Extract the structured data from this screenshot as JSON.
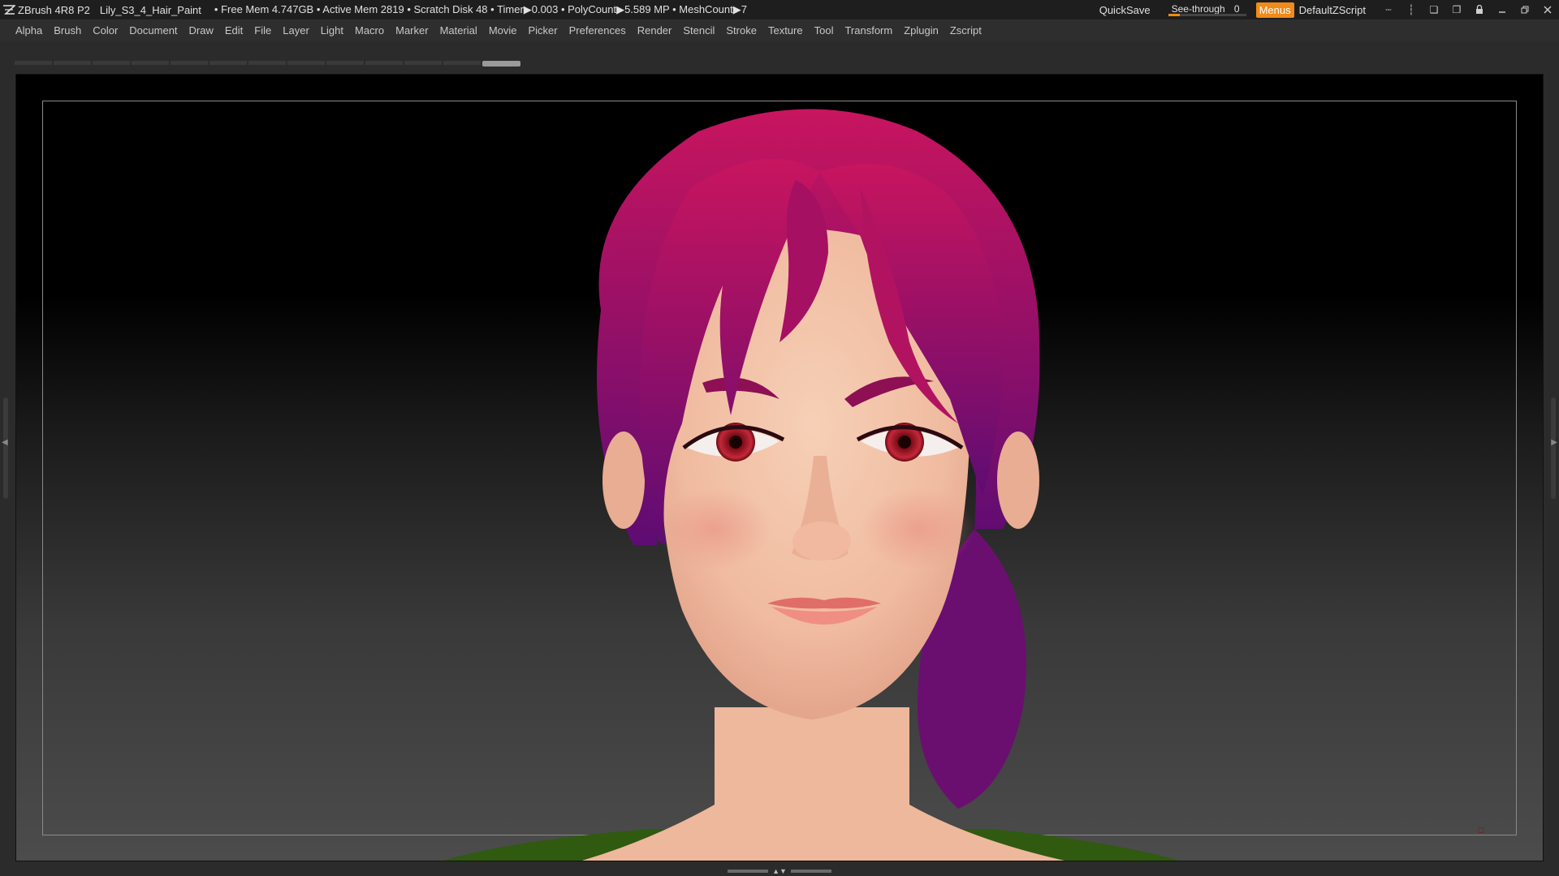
{
  "titlebar": {
    "app": "ZBrush 4R8 P2",
    "file": "Lily_S3_4_Hair_Paint",
    "stats": "• Free Mem 4.747GB • Active Mem 2819 • Scratch Disk 48 •  Timer▶0.003 • PolyCount▶5.589 MP  • MeshCount▶7",
    "quicksave": "QuickSave",
    "see_through_label": "See-through",
    "see_through_value": "0",
    "see_through_fraction": 0,
    "menus_label": "Menus",
    "zscript_label": "DefaultZScript"
  },
  "menubar": {
    "items": [
      "Alpha",
      "Brush",
      "Color",
      "Document",
      "Draw",
      "Edit",
      "File",
      "Layer",
      "Light",
      "Macro",
      "Marker",
      "Material",
      "Movie",
      "Picker",
      "Preferences",
      "Render",
      "Stencil",
      "Stroke",
      "Texture",
      "Tool",
      "Transform",
      "Zplugin",
      "Zscript"
    ]
  },
  "colors": {
    "accent": "#f08a1a",
    "hair": "#b0125c",
    "hair_dark": "#6a0f6e",
    "skin": "#f2c4aa",
    "iris": "#b01e2e"
  },
  "icons": [
    "zbrush-logo-icon",
    "layout-a-icon",
    "layout-b-icon",
    "popup-icon",
    "popup2-icon",
    "lock-icon",
    "minimize-icon",
    "restore-icon",
    "close-icon"
  ]
}
